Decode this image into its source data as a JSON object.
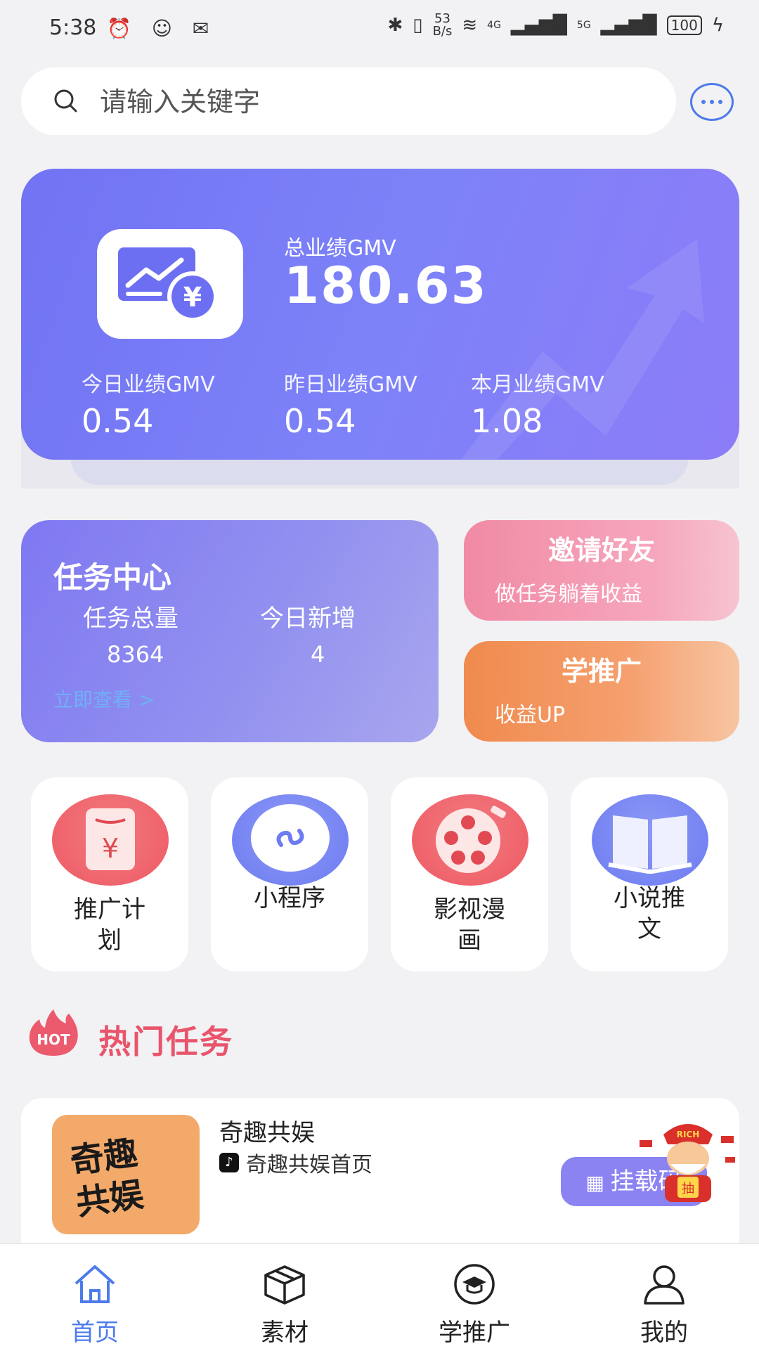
{
  "status_bar": {
    "time": "5:38",
    "left_icons": "⏰ ☺ ✉",
    "net_speed_value": "53",
    "net_speed_unit": "B/s",
    "signal_1": "4G",
    "signal_2": "5G",
    "battery": "100"
  },
  "search": {
    "placeholder": "请输入关键字"
  },
  "gmv": {
    "total_label": "总业绩GMV",
    "total_value": "180.63",
    "stats": [
      {
        "label": "今日业绩GMV",
        "value": "0.54"
      },
      {
        "label": "昨日业绩GMV",
        "value": "0.54"
      },
      {
        "label": "本月业绩GMV",
        "value": "1.08"
      }
    ]
  },
  "task_center": {
    "title": "任务中心",
    "total_label": "任务总量",
    "total_value": "8364",
    "new_label": "今日新增",
    "new_value": "4",
    "link": "立即查看 >"
  },
  "invite": {
    "title": "邀请好友",
    "subtitle": "做任务躺着收益"
  },
  "learn": {
    "title": "学推广",
    "subtitle": "收益UP"
  },
  "entries": [
    {
      "line1": "推广计",
      "line2": "划",
      "icon": "red-envelope-yuan-icon",
      "color": "#f0606a"
    },
    {
      "line1": "小程序",
      "line2": "",
      "icon": "mini-program-icon",
      "color": "#6d7cf2"
    },
    {
      "line1": "影视漫",
      "line2": "画",
      "icon": "film-reel-icon",
      "color": "#f0606a"
    },
    {
      "line1": "小说推",
      "line2": "文",
      "icon": "open-book-icon",
      "color": "#6d7cf2"
    }
  ],
  "hot": {
    "badge": "HOT",
    "title": "热门任务"
  },
  "hot_task": {
    "thumb_text_1": "奇趣",
    "thumb_text_2": "共娱",
    "title": "奇趣共娱",
    "subtitle": "奇趣共娱首页",
    "button": "挂载码",
    "fortune_text": "RICH",
    "fortune_sign": "抽"
  },
  "tabs": [
    {
      "label": "首页",
      "icon": "home-icon",
      "active": true
    },
    {
      "label": "素材",
      "icon": "box-icon",
      "active": false
    },
    {
      "label": "学推广",
      "icon": "graduation-cap-icon",
      "active": false
    },
    {
      "label": "我的",
      "icon": "user-icon",
      "active": false
    }
  ],
  "colors": {
    "accent": "#4d7bea",
    "gmv_card": "#7173f3",
    "hot_red": "#e9556b",
    "mount_button": "#8c83f3"
  }
}
